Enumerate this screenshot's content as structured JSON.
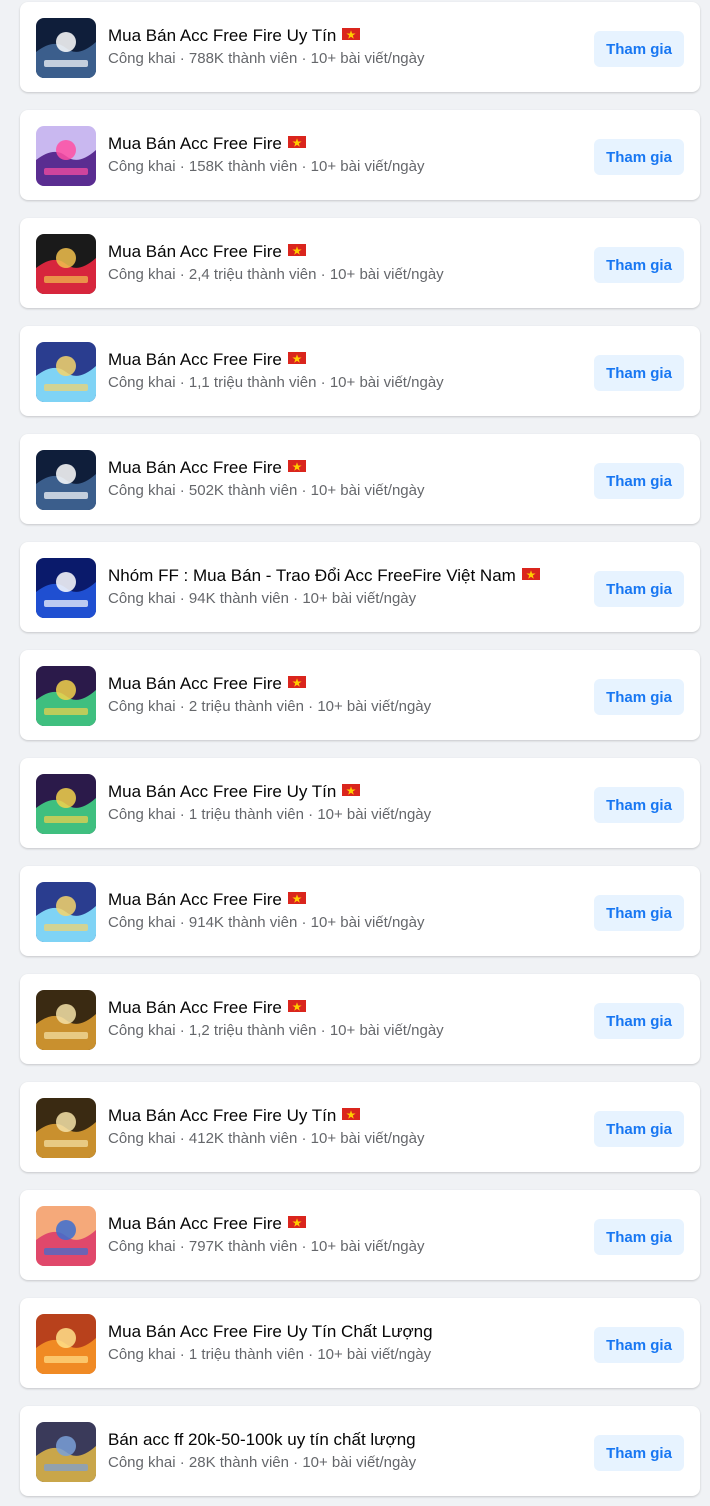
{
  "join_label": "Tham gia",
  "flag_icon": "vietnam-flag-icon",
  "colors": {
    "join_bg": "#e7f3ff",
    "join_text": "#1877f2",
    "page_bg": "#f0f2f5"
  },
  "groups": [
    {
      "name": "Mua Bán Acc Free Fire Uy Tín",
      "flag": true,
      "privacy": "Công khai",
      "members": "788K thành viên",
      "activity": "10+ bài viết/ngày",
      "thumb": [
        "#0f1e3a",
        "#3b5e8c",
        "#ffffff"
      ]
    },
    {
      "name": "Mua Bán Acc Free Fire",
      "flag": true,
      "privacy": "Công khai",
      "members": "158K thành viên",
      "activity": "10+ bài viết/ngày",
      "thumb": [
        "#c9b8f0",
        "#5a2d91",
        "#ff4fa3"
      ]
    },
    {
      "name": "Mua Bán Acc Free Fire",
      "flag": true,
      "privacy": "Công khai",
      "members": "2,4 triệu thành viên",
      "activity": "10+ bài viết/ngày",
      "thumb": [
        "#1a1a1a",
        "#d7263d",
        "#f2c14e"
      ]
    },
    {
      "name": "Mua Bán Acc Free Fire",
      "flag": true,
      "privacy": "Công khai",
      "members": "1,1 triệu thành viên",
      "activity": "10+ bài viết/ngày",
      "thumb": [
        "#2a3d8f",
        "#7fd3f5",
        "#f5d36b"
      ]
    },
    {
      "name": "Mua Bán Acc Free Fire",
      "flag": true,
      "privacy": "Công khai",
      "members": "502K thành viên",
      "activity": "10+ bài viết/ngày",
      "thumb": [
        "#0f1e3a",
        "#3b5e8c",
        "#ffffff"
      ]
    },
    {
      "name": "Nhóm FF : Mua Bán - Trao Đổi Acc FreeFire Việt Nam",
      "flag": true,
      "privacy": "Công khai",
      "members": "94K thành viên",
      "activity": "10+ bài viết/ngày",
      "thumb": [
        "#0a1a6b",
        "#1f4fd1",
        "#ffffff"
      ]
    },
    {
      "name": "Mua Bán Acc Free Fire",
      "flag": true,
      "privacy": "Công khai",
      "members": "2 triệu thành viên",
      "activity": "10+ bài viết/ngày",
      "thumb": [
        "#2b1a4a",
        "#3fbf7f",
        "#f2d24b"
      ]
    },
    {
      "name": "Mua Bán Acc Free Fire Uy Tín",
      "flag": true,
      "privacy": "Công khai",
      "members": "1 triệu thành viên",
      "activity": "10+ bài viết/ngày",
      "thumb": [
        "#2b1a4a",
        "#3fbf7f",
        "#f2d24b"
      ]
    },
    {
      "name": "Mua Bán Acc Free Fire",
      "flag": true,
      "privacy": "Công khai",
      "members": "914K thành viên",
      "activity": "10+ bài viết/ngày",
      "thumb": [
        "#2a3d8f",
        "#7fd3f5",
        "#f5d36b"
      ]
    },
    {
      "name": "Mua Bán Acc Free Fire",
      "flag": true,
      "privacy": "Công khai",
      "members": "1,2 triệu thành viên",
      "activity": "10+ bài viết/ngày",
      "thumb": [
        "#3a2a12",
        "#c9902e",
        "#f5e2a8"
      ]
    },
    {
      "name": "Mua Bán Acc Free Fire Uy Tín",
      "flag": true,
      "privacy": "Công khai",
      "members": "412K thành viên",
      "activity": "10+ bài viết/ngày",
      "thumb": [
        "#3a2a12",
        "#c9902e",
        "#f5e2a8"
      ]
    },
    {
      "name": "Mua Bán Acc Free Fire",
      "flag": true,
      "privacy": "Công khai",
      "members": "797K thành viên",
      "activity": "10+ bài viết/ngày",
      "thumb": [
        "#f5a97a",
        "#e0486b",
        "#3b6fd1"
      ]
    },
    {
      "name": "Mua Bán Acc Free Fire Uy Tín Chất Lượng",
      "flag": false,
      "privacy": "Công khai",
      "members": "1 triệu thành viên",
      "activity": "10+ bài viết/ngày",
      "thumb": [
        "#b8411c",
        "#f08a24",
        "#ffe08a"
      ]
    },
    {
      "name": "Bán acc ff 20k-50-100k uy tín chất lượng",
      "flag": false,
      "privacy": "Công khai",
      "members": "28K thành viên",
      "activity": "10+ bài viết/ngày",
      "thumb": [
        "#3a3a5a",
        "#c9a64a",
        "#7aa0d8"
      ]
    }
  ]
}
